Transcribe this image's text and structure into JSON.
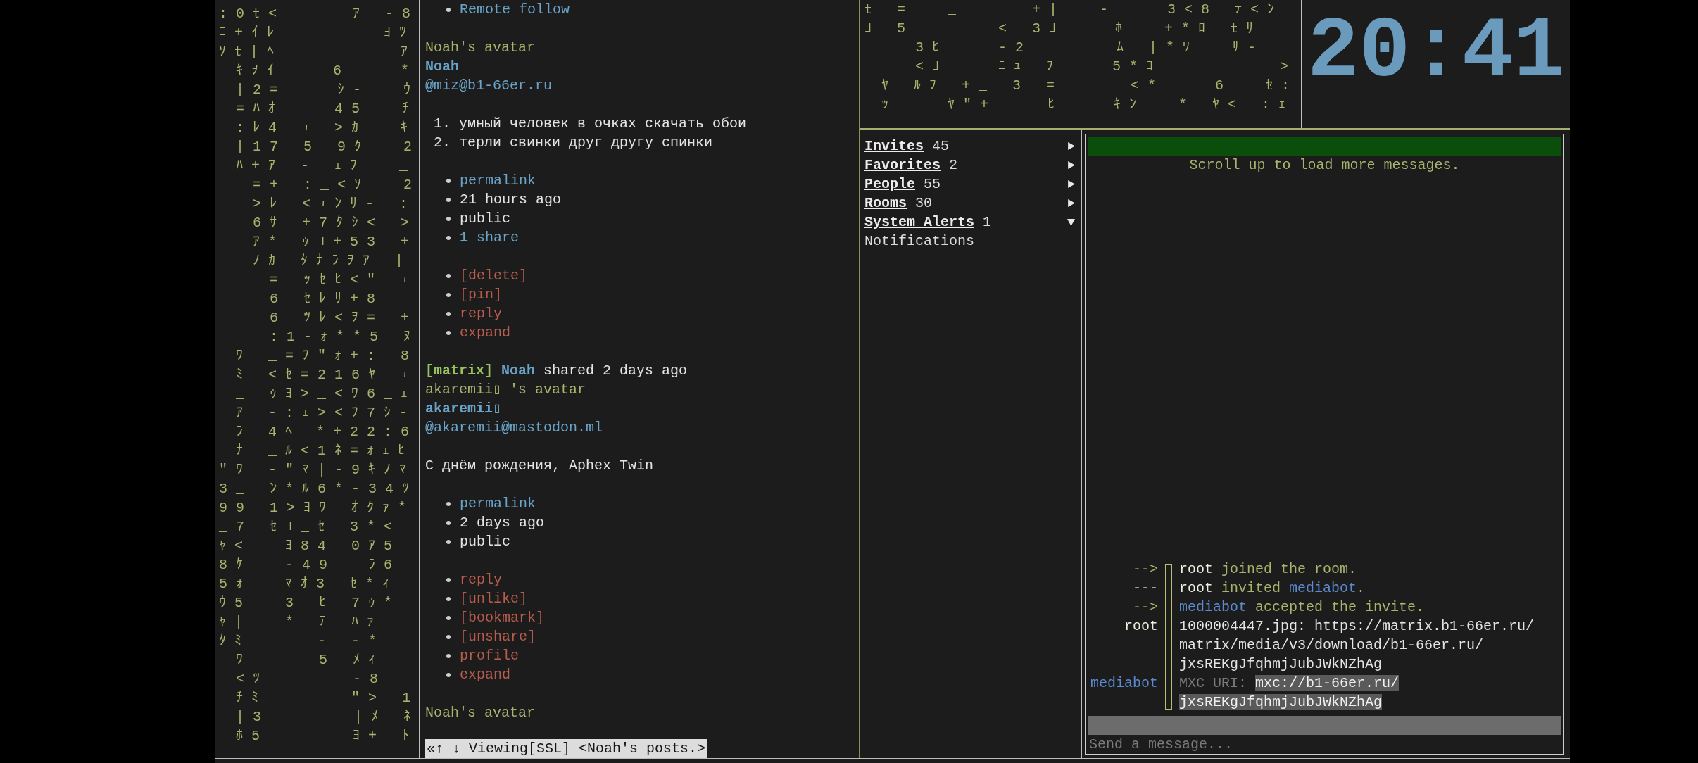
{
  "left_rain": [
    ": 0 ﾓ <         ｱ   - 8",
    "ﾆ + ｲ ﾚ             ﾖ ﾂ",
    "ｿ ﾓ | ﾍ               ｱ",
    "  ｷ ｦ ｲ       6       *",
    "  | 2 =       ｼ -     ｳ",
    "  = ﾊ ｵ       4 5     ﾁ",
    "  : ﾚ 4   ｭ   > ｶ     ｷ",
    "  | 1 7   5   9 ｸ     2",
    "  ﾊ + ｱ   -   ｪ ﾌ     _",
    "    = +   : _ < ｿ     2",
    "    > ﾚ   < ｭ ﾝ ﾘ -   :",
    "    6 ｻ   + 7 ﾀ ｼ <   >",
    "    ｱ *   ｩ ｺ + 5 3   +",
    "    ﾉ ｶ   ﾀ ﾅ ﾗ ｦ ｱ   |",
    "      =   ｯ ｾ ﾋ < \"   ｭ",
    "      6   ｾ ﾚ ﾘ + 8   ﾆ",
    "      6   ﾂ ﾚ < ｦ =   +",
    "      : 1 - ｫ * * 5   ﾇ",
    "  ﾜ   _ = ﾌ \" ｫ + :   8",
    "  ﾐ   < ｾ = 2 1 6 ﾔ   ｭ",
    "  _   ｩ ﾖ > _ < ﾜ 6 _ ｪ",
    "  ｱ   - : ｪ > < ﾌ 7 ｼ -",
    "  ﾗ   4 ﾍ ﾆ * + 2 2 : 6",
    "  ﾅ   _ ﾙ < 1 ﾈ = ｫ ｪ ﾋ",
    "\" ﾜ   - \" ﾏ | - 9 ｷ ﾉ ﾏ",
    "3 _   ﾝ * ﾙ 6 * - 3 4 ﾂ",
    "9 9   1 > ﾖ ﾜ   ｵ ｸ ｧ *",
    "_ 7   ｾ ｺ _ ｾ   3 * <",
    "ｬ <     ﾖ 8 4   0 ｱ 5",
    "8 ｹ     - 4 9   ﾆ ﾗ 6",
    "5 ｫ     ﾏ ｵ 3   ｾ * ｨ",
    "ｳ 5     3   ﾋ   7 ｩ *",
    "ｬ |     *   ﾃ   ﾊ ｧ",
    "ﾀ ﾐ         -   - *",
    "  ﾜ         5   ﾒ ｨ",
    "  < ﾂ           - 8   ﾆ",
    "  ﾁ ﾐ           \" >   1",
    "  | 3           | ﾒ   ﾈ",
    "  ﾎ 5           ﾖ +   ﾄ"
  ],
  "feed": [
    {
      "kind": "link_item",
      "text": "Remote follow"
    },
    {
      "kind": "blank"
    },
    {
      "kind": "avatar_alt",
      "text": "Noah's avatar"
    },
    {
      "kind": "name",
      "text": "Noah"
    },
    {
      "kind": "handle",
      "text": "@miz@b1-66er.ru"
    },
    {
      "kind": "blank"
    },
    {
      "kind": "numbered",
      "number": "1.",
      "text": "умный человек в очках скачать обои"
    },
    {
      "kind": "numbered",
      "number": "2.",
      "text": "терли свинки друг другу спинки"
    },
    {
      "kind": "blank"
    },
    {
      "kind": "link_item",
      "text": "permalink"
    },
    {
      "kind": "info_item",
      "text": "21 hours ago"
    },
    {
      "kind": "info_item",
      "text": "public"
    },
    {
      "kind": "link_item",
      "text": "**1** share"
    },
    {
      "kind": "blank"
    },
    {
      "kind": "action_item",
      "text": "[delete]"
    },
    {
      "kind": "action_item",
      "text": "[pin]"
    },
    {
      "kind": "action_item",
      "text": "reply"
    },
    {
      "kind": "action_item",
      "text": "expand"
    },
    {
      "kind": "blank"
    },
    {
      "kind": "share_header",
      "tag": "[matrix]",
      "name": "Noah",
      "text": "shared 2 days ago"
    },
    {
      "kind": "avatar_alt",
      "text": "akaremii▯ 's avatar"
    },
    {
      "kind": "name",
      "text": "akaremii▯"
    },
    {
      "kind": "handle",
      "text": "@akaremii@mastodon.ml"
    },
    {
      "kind": "blank"
    },
    {
      "kind": "plain",
      "text": "С днём рождения, Aphex Twin"
    },
    {
      "kind": "blank"
    },
    {
      "kind": "link_item",
      "text": "permalink"
    },
    {
      "kind": "info_item",
      "text": "2 days ago"
    },
    {
      "kind": "info_item",
      "text": "public"
    },
    {
      "kind": "blank"
    },
    {
      "kind": "action_item",
      "text": "reply"
    },
    {
      "kind": "action_item",
      "text": "[unlike]"
    },
    {
      "kind": "action_item",
      "text": "[bookmark]"
    },
    {
      "kind": "action_item",
      "text": "[unshare]"
    },
    {
      "kind": "action_item",
      "text": "profile"
    },
    {
      "kind": "action_item",
      "text": "expand"
    },
    {
      "kind": "blank"
    },
    {
      "kind": "avatar_alt",
      "text": "Noah's avatar"
    }
  ],
  "browser_status": "«↑ ↓ Viewing[SSL] <Noah's posts.>",
  "top_rain": [
    "ﾓ   =     _         + |     -       3 < 8   ﾃ < ﾝ",
    "ﾖ   5           <   3 ﾖ       ﾎ     + * ﾛ   ﾓ ﾘ",
    "      3 ﾋ       - 2           ﾑ   | * ﾜ     ｻ -",
    "      < ﾖ       ﾆ ｭ   ﾌ       5 * ｺ               >",
    "  ﾔ   ﾙ ﾌ   + _   3   =         < *       6     ｾ :",
    "  ｯ       ﾔ \" +       ﾋ       ｷ ﾝ     *   ﾔ <   : ｪ"
  ],
  "clock": "20:41",
  "sidebar": [
    {
      "label": "Invites",
      "count": "45",
      "expanded": false
    },
    {
      "label": "Favorites",
      "count": "2",
      "expanded": false
    },
    {
      "label": "People",
      "count": "55",
      "expanded": false
    },
    {
      "label": "Rooms",
      "count": "30",
      "expanded": false
    },
    {
      "label": "System Alerts",
      "count": "1",
      "expanded": true,
      "children": [
        {
          "label": "Notifications"
        }
      ]
    }
  ],
  "chat": {
    "notice": "Scroll up to load more messages.",
    "messages": [
      {
        "sender": {
          "text": "-->",
          "kind": "event"
        },
        "lines": [
          [
            {
              "text": "root",
              "kind": "user"
            },
            {
              "text": " joined the room.",
              "kind": "event"
            }
          ]
        ]
      },
      {
        "sender": {
          "text": "---",
          "kind": "user"
        },
        "lines": [
          [
            {
              "text": "root",
              "kind": "user"
            },
            {
              "text": " invited ",
              "kind": "event"
            },
            {
              "text": "mediabot",
              "kind": "mention"
            },
            {
              "text": ".",
              "kind": "event"
            }
          ]
        ]
      },
      {
        "sender": {
          "text": "-->",
          "kind": "event"
        },
        "lines": [
          [
            {
              "text": "mediabot",
              "kind": "mention"
            },
            {
              "text": " accepted the invite.",
              "kind": "event"
            }
          ]
        ]
      },
      {
        "sender": {
          "text": "root",
          "kind": "user"
        },
        "lines": [
          [
            {
              "text": "1000004447.jpg: https://matrix.b1-66er.ru/_",
              "kind": "body"
            }
          ],
          [
            {
              "text": "matrix/media/v3/download/b1-66er.ru/",
              "kind": "body"
            }
          ],
          [
            {
              "text": "jxsREKgJfqhmjJubJWkNZhAg",
              "kind": "body"
            }
          ]
        ]
      },
      {
        "sender": {
          "text": "mediabot",
          "kind": "mention"
        },
        "lines": [
          [
            {
              "text": "MXC URI: ",
              "kind": "dim"
            },
            {
              "text": "mxc://b1-66er.ru/",
              "kind": "highlight"
            }
          ],
          [
            {
              "text": "jxsREKgJfqhmjJubJWkNZhAg",
              "kind": "highlight"
            }
          ]
        ]
      }
    ],
    "composer": {
      "placeholder": "Send a message..."
    }
  }
}
